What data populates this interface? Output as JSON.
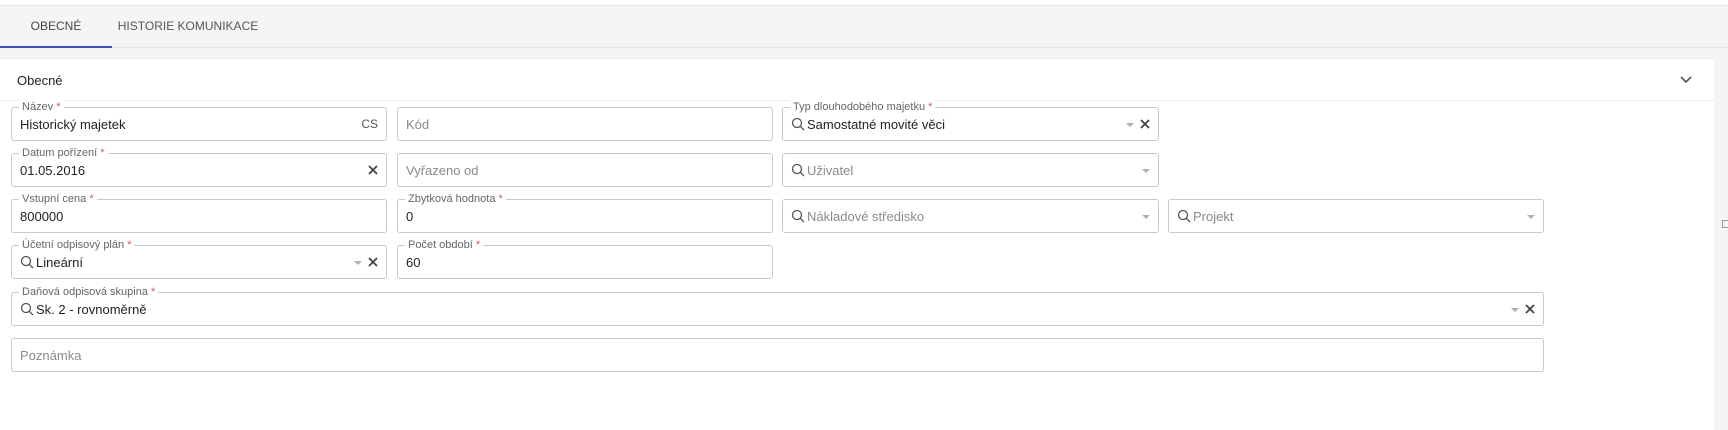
{
  "tabs": [
    {
      "label": "OBECNÉ"
    },
    {
      "label": "HISTORIE KOMUNIKACE"
    }
  ],
  "section": {
    "title": "Obecné"
  },
  "fields": {
    "nazev": {
      "label": "Název",
      "value": "Historický majetek",
      "lang": "CS"
    },
    "kod": {
      "placeholder": "Kód"
    },
    "typ": {
      "label": "Typ dlouhodobého majetku",
      "value": "Samostatné movité věci"
    },
    "datum": {
      "label": "Datum pořízení",
      "value": "01.05.2016"
    },
    "vyrazeno": {
      "placeholder": "Vyřazeno od"
    },
    "uzivatel": {
      "placeholder": "Uživatel"
    },
    "cena": {
      "label": "Vstupní cena",
      "value": "800000"
    },
    "zbytkova": {
      "label": "Zbytková hodnota",
      "value": "0"
    },
    "stredisko": {
      "placeholder": "Nákladové středisko"
    },
    "projekt": {
      "placeholder": "Projekt"
    },
    "plan": {
      "label": "Účetní odpisový plán",
      "value": "Lineární"
    },
    "obdobi": {
      "label": "Počet období",
      "value": "60"
    },
    "skupina": {
      "label": "Daňová odpisová skupina",
      "value": "Sk. 2 - rovnoměrně"
    },
    "poznamka": {
      "placeholder": "Poznámka"
    }
  },
  "required_mark": "*",
  "icons": {
    "search": "search-icon",
    "clear": "close-icon",
    "dropdown": "chevron-down-icon",
    "collapse": "chevron-up-icon"
  },
  "colors": {
    "accent": "#3f51b5",
    "required": "#e05555"
  }
}
